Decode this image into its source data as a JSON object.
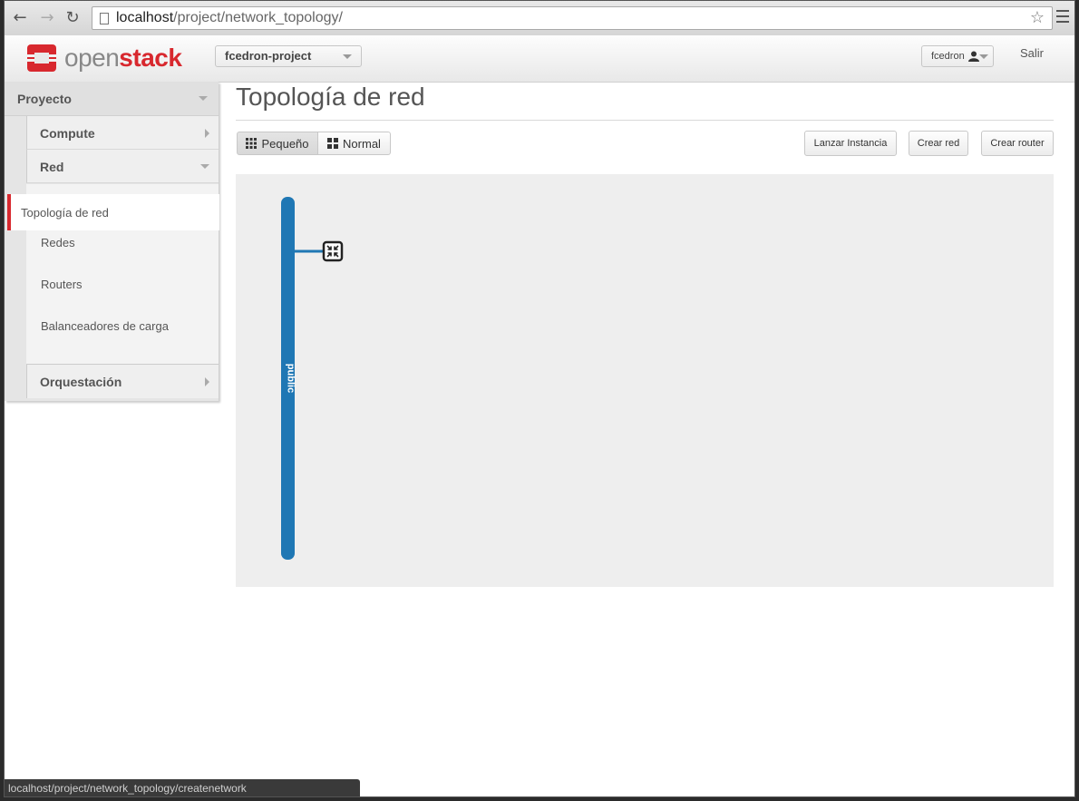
{
  "browser": {
    "url_host": "localhost",
    "url_path": "/project/network_topology/",
    "status_url": "localhost/project/network_topology/createnetwork"
  },
  "header": {
    "logo_open": "open",
    "logo_stack": "stack",
    "project_selector": "fcedron-project",
    "user_menu": "fcedron",
    "logout": "Salir"
  },
  "sidebar": {
    "dashboard": "Proyecto",
    "compute": "Compute",
    "red": "Red",
    "items": [
      {
        "label": "Topología de red",
        "active": true
      },
      {
        "label": "Redes"
      },
      {
        "label": "Routers"
      },
      {
        "label": "Balanceadores de carga"
      }
    ],
    "orquestacion": "Orquestación"
  },
  "main": {
    "title": "Topología de red",
    "view_small": "Pequeño",
    "view_normal": "Normal",
    "launch_instance": "Lanzar Instancia",
    "create_network": "Crear red",
    "create_router": "Crear router"
  },
  "topology": {
    "networks": [
      {
        "name": "public",
        "color": "#1f77b4"
      }
    ],
    "routers": [
      {
        "name": "router",
        "icon": "router-icon"
      }
    ]
  },
  "colors": {
    "accent": "#d8282e",
    "network": "#1f77b4"
  }
}
